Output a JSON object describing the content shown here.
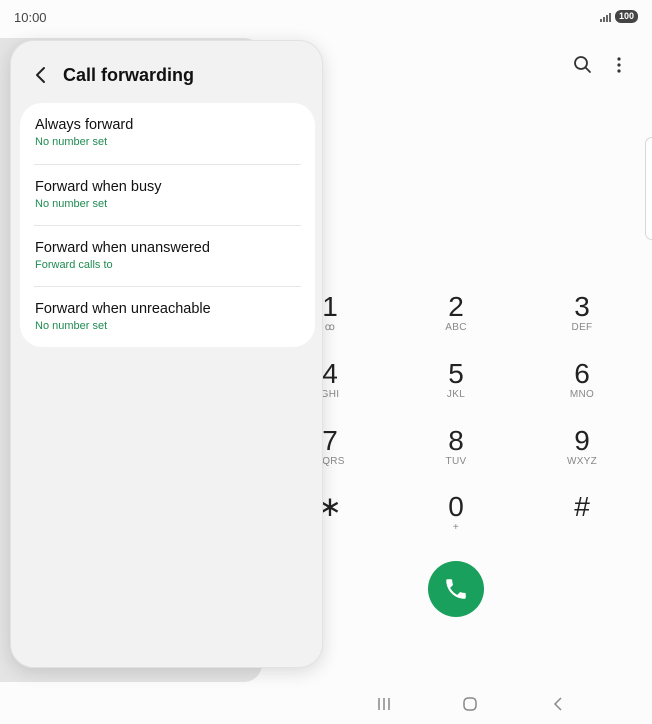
{
  "status": {
    "time": "10:00",
    "battery": "100"
  },
  "panel": {
    "title": "Call forwarding",
    "items": [
      {
        "title": "Always forward",
        "subtitle": "No number set"
      },
      {
        "title": "Forward when busy",
        "subtitle": "No number set"
      },
      {
        "title": "Forward when unanswered",
        "subtitle": "Forward calls to"
      },
      {
        "title": "Forward when unreachable",
        "subtitle": "No number set"
      }
    ]
  },
  "dialpad": {
    "keys": [
      {
        "digit": "1",
        "letters": "ꝏ"
      },
      {
        "digit": "2",
        "letters": "ABC"
      },
      {
        "digit": "3",
        "letters": "DEF"
      },
      {
        "digit": "4",
        "letters": "GHI"
      },
      {
        "digit": "5",
        "letters": "JKL"
      },
      {
        "digit": "6",
        "letters": "MNO"
      },
      {
        "digit": "7",
        "letters": "PQRS"
      },
      {
        "digit": "8",
        "letters": "TUV"
      },
      {
        "digit": "9",
        "letters": "WXYZ"
      },
      {
        "digit": "∗",
        "letters": ""
      },
      {
        "digit": "0",
        "letters": "+"
      },
      {
        "digit": "#",
        "letters": ""
      }
    ]
  },
  "colors": {
    "call_green": "#1aa05d",
    "subtitle_green": "#1f8b52"
  },
  "icons": {
    "search": "search-icon",
    "more": "more-vert-icon",
    "back": "chevron-left-icon",
    "call": "phone-icon",
    "nav_recent": "recents-icon",
    "nav_home": "home-icon",
    "nav_back": "back-icon"
  }
}
